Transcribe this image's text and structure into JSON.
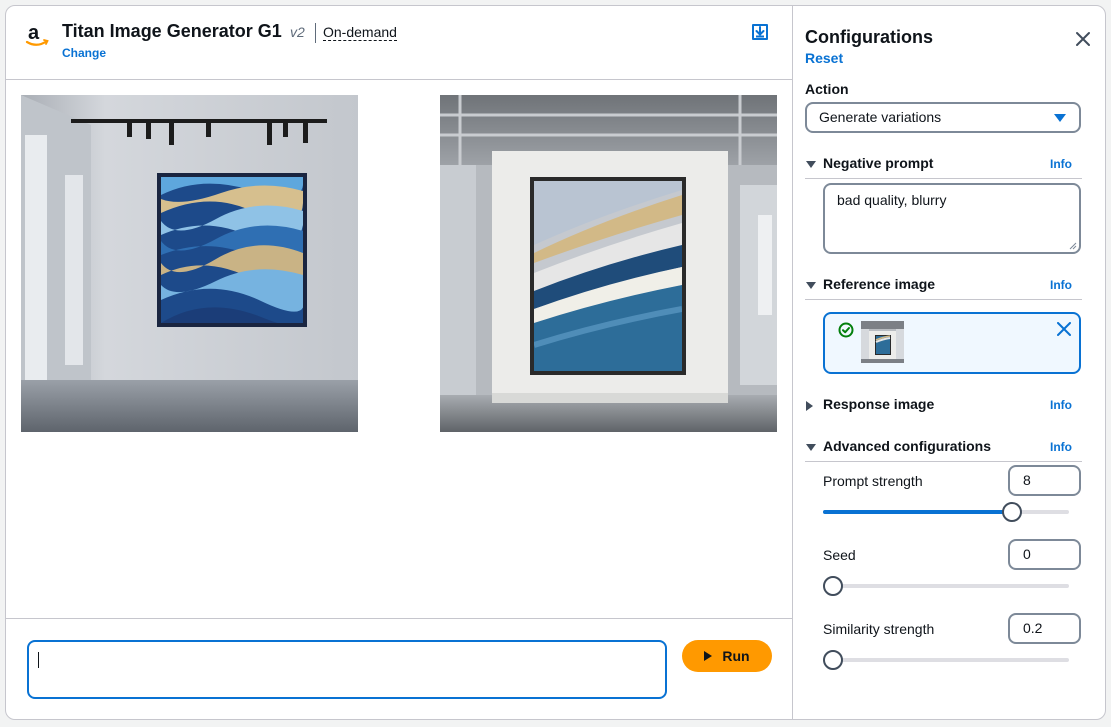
{
  "header": {
    "model_name": "Titan Image Generator G1",
    "version": "v2",
    "throughput": "On-demand",
    "change_label": "Change",
    "logo_letter": "a"
  },
  "prompt": {
    "value": "",
    "run_label": "Run"
  },
  "config": {
    "title": "Configurations",
    "reset_label": "Reset",
    "action": {
      "label": "Action",
      "selected": "Generate variations"
    },
    "negative_prompt": {
      "title": "Negative prompt",
      "info": "Info",
      "value": "bad quality, blurry",
      "expanded": true
    },
    "reference_image": {
      "title": "Reference image",
      "info": "Info",
      "expanded": true,
      "status": "uploaded"
    },
    "response_image": {
      "title": "Response image",
      "info": "Info",
      "expanded": false
    },
    "advanced": {
      "title": "Advanced configurations",
      "info": "Info",
      "expanded": true,
      "prompt_strength": {
        "label": "Prompt strength",
        "value": "8",
        "fraction": 0.79
      },
      "seed": {
        "label": "Seed",
        "value": "0",
        "fraction": 0.0
      },
      "similarity_strength": {
        "label": "Similarity strength",
        "value": "0.2",
        "fraction": 0.0
      }
    }
  },
  "colors": {
    "accent": "#0972d3",
    "run_button": "#ff9900",
    "border": "#c6c6cd"
  },
  "icons": [
    "amazon-logo-icon",
    "export-icon",
    "close-icon",
    "success-check-icon",
    "remove-icon",
    "play-icon",
    "caret-down-icon"
  ]
}
